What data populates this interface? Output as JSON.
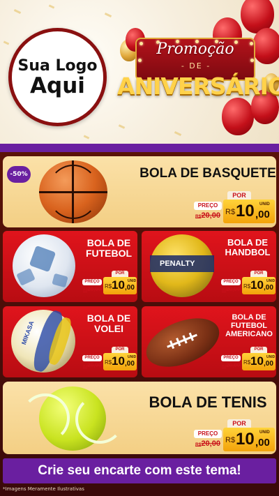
{
  "header": {
    "logo_line1": "Sua Logo",
    "logo_line2": "Aqui",
    "banner_title": "Promoção",
    "banner_de": "- DE -",
    "banner_main": "ANIVERSÁRIO"
  },
  "labels": {
    "por": "POR",
    "preco": "PREÇO",
    "currency": "R$",
    "unid": "UNID"
  },
  "products": {
    "basquete": {
      "badge": "-50%",
      "name": "BOLA DE BASQUETE",
      "old_price": "20,00",
      "price_int": "10",
      "price_cents": ",00"
    },
    "futebol": {
      "name_line1": "BOLA DE",
      "name_line2": "FUTEBOL",
      "old_price": "20,00",
      "price_int": "10",
      "price_cents": ",00"
    },
    "handbol": {
      "name_line1": "BOLA DE",
      "name_line2": "HANDBOL",
      "old_price": "20,00",
      "price_int": "10",
      "price_cents": ",00"
    },
    "volei": {
      "name_line1": "BOLA DE",
      "name_line2": "VOLEI",
      "old_price": "20,00",
      "price_int": "10",
      "price_cents": ",00"
    },
    "americano": {
      "name_line1": "BOLA DE",
      "name_line2": "FUTEBOL",
      "name_line3": "AMERICANO",
      "old_price": "20,00",
      "price_int": "10",
      "price_cents": ",00"
    },
    "tenis": {
      "name": "BOLA DE TENIS",
      "old_price": "20,00",
      "price_int": "10",
      "price_cents": ",00"
    }
  },
  "ball_brands": {
    "handbol": "PENALTY",
    "volei": "MIKASA"
  },
  "cta": "Crie seu encarte com este tema!",
  "disclaimer": "*Imagens Meramente Ilustrativas",
  "colors": {
    "brand_purple": "#6a1fa0",
    "card_red": "#e0141c",
    "card_cream": "#fbe1a8",
    "price_yellow": "#ffd33a",
    "price_red": "#c8101a"
  }
}
